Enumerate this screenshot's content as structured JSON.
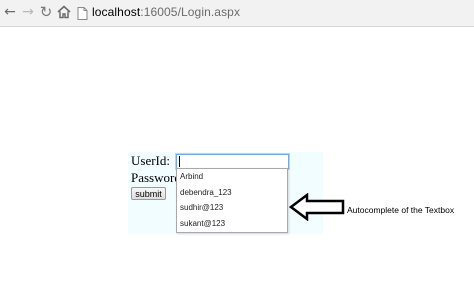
{
  "browser": {
    "url_host": "localhost",
    "url_path": ":16005/Login.aspx"
  },
  "form": {
    "userid_label": "UserId:",
    "password_label": "Password:",
    "submit_label": "submit"
  },
  "autocomplete": {
    "items": [
      "Arbind",
      "debendra_123",
      "sudhir@123",
      "sukant@123"
    ]
  },
  "annotation": {
    "text": "Autocomplete of the Textbox"
  }
}
